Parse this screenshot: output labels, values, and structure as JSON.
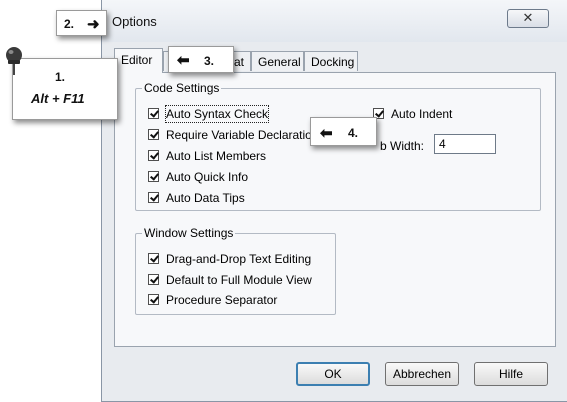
{
  "dialog": {
    "title": "Options",
    "close_symbol": "✕"
  },
  "tabs": [
    {
      "label": "Editor",
      "active": true
    },
    {
      "label": "at",
      "active": false
    },
    {
      "label": "General",
      "active": false
    },
    {
      "label": "Docking",
      "active": false
    }
  ],
  "code_settings": {
    "title": "Code Settings",
    "options": [
      {
        "label": "Auto Syntax Check",
        "checked": true
      },
      {
        "label": "Require Variable Declaration",
        "checked": true
      },
      {
        "label": "Auto List Members",
        "checked": true
      },
      {
        "label": "Auto Quick Info",
        "checked": true
      },
      {
        "label": "Auto Data Tips",
        "checked": true
      }
    ],
    "auto_indent": {
      "label": "Auto Indent",
      "checked": true
    },
    "tab_width": {
      "label": "b Width:",
      "value": "4"
    }
  },
  "window_settings": {
    "title": "Window Settings",
    "options": [
      {
        "label": "Drag-and-Drop Text Editing",
        "checked": true
      },
      {
        "label": "Default to Full Module View",
        "checked": true
      },
      {
        "label": "Procedure Separator",
        "checked": true
      }
    ]
  },
  "buttons": {
    "ok": "OK",
    "cancel": "Abbrechen",
    "help": "Hilfe"
  },
  "callouts": {
    "step1_number": "1.",
    "step1_text": "Alt + F11",
    "step2_number": "2.",
    "step3_number": "3.",
    "step4_number": "4.",
    "arrow_right": "➜",
    "arrow_left": "⬅"
  },
  "colors": {
    "dialog_background": "#e8ebef",
    "panel_background": "#f7f8fa",
    "default_button_border": "#3c7fb1"
  }
}
